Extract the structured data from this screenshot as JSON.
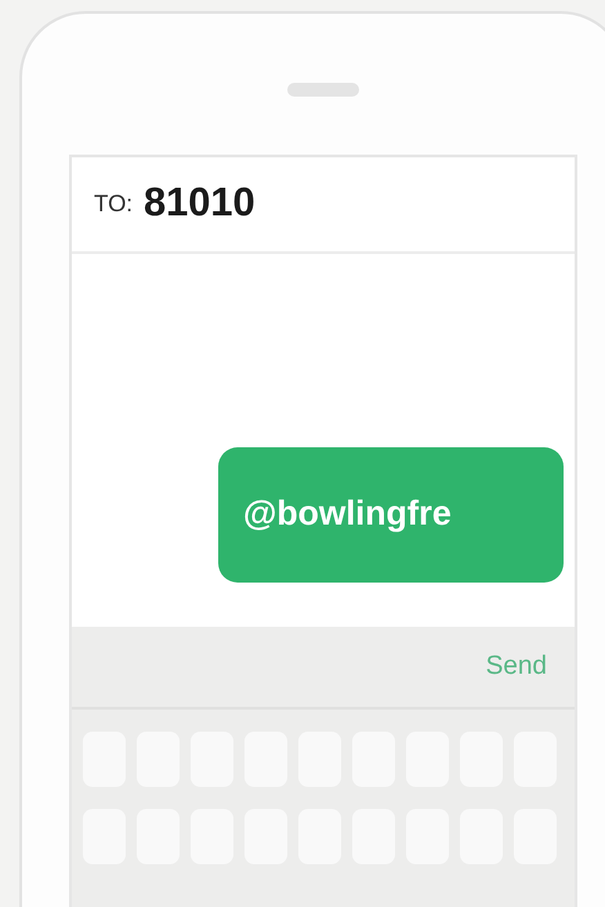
{
  "recipient": {
    "label": "TO:",
    "number": "81010"
  },
  "messages": [
    {
      "text": "@bowlingfre",
      "outgoing": true
    }
  ],
  "send_button": {
    "label": "Send",
    "disabled": false
  }
}
